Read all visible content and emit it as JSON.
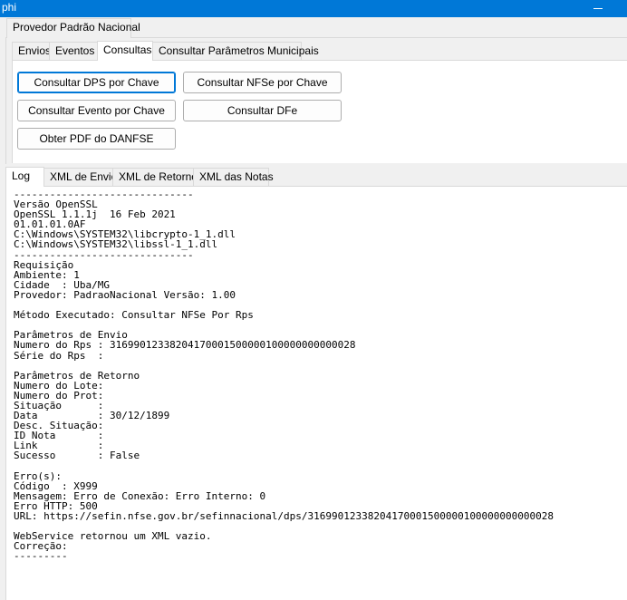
{
  "window": {
    "title": "phi"
  },
  "main_tabs": [
    {
      "label": "Provedor Padrão Nacional",
      "active": true
    }
  ],
  "section_tabs": [
    {
      "label": "Envios",
      "active": false
    },
    {
      "label": "Eventos",
      "active": false
    },
    {
      "label": "Consultas",
      "active": true
    },
    {
      "label": "Consultar Parâmetros Municipais",
      "active": false
    }
  ],
  "buttons": {
    "consultar_dps": "Consultar DPS por Chave",
    "consultar_nfse": "Consultar NFSe por Chave",
    "consultar_evento": "Consultar Evento por Chave",
    "consultar_dfe": "Consultar DFe",
    "obter_pdf": "Obter PDF do DANFSE"
  },
  "log_tabs": [
    {
      "label": "Log",
      "active": true
    },
    {
      "label": "XML de Envio",
      "active": false
    },
    {
      "label": "XML de Retorno",
      "active": false
    },
    {
      "label": "XML das Notas",
      "active": false
    }
  ],
  "log_lines": [
    "------------------------------",
    "Versão OpenSSL",
    "OpenSSL 1.1.1j  16 Feb 2021",
    "01.01.01.0AF",
    "C:\\Windows\\SYSTEM32\\libcrypto-1_1.dll",
    "C:\\Windows\\SYSTEM32\\libssl-1_1.dll",
    "------------------------------",
    "Requisição",
    "Ambiente: 1",
    "Cidade  : Uba/MG",
    "Provedor: PadraoNacional Versão: 1.00",
    "",
    "Método Executado: Consultar NFSe Por Rps",
    "",
    "Parâmetros de Envio",
    "Numero do Rps : 31699012338204170001500000100000000000028",
    "Série do Rps  :",
    "",
    "Parâmetros de Retorno",
    "Numero do Lote:",
    "Numero do Prot:",
    "Situação      :",
    "Data          : 30/12/1899",
    "Desc. Situação:",
    "ID Nota       :",
    "Link          :",
    "Sucesso       : False",
    "",
    "Erro(s):",
    "Código  : X999",
    "Mensagem: Erro de Conexão: Erro Interno: 0",
    "Erro HTTP: 500",
    "URL: https://sefin.nfse.gov.br/sefinnacional/dps/31699012338204170001500000100000000000028",
    "",
    "WebService retornou um XML vazio.",
    "Correção:",
    "---------"
  ]
}
